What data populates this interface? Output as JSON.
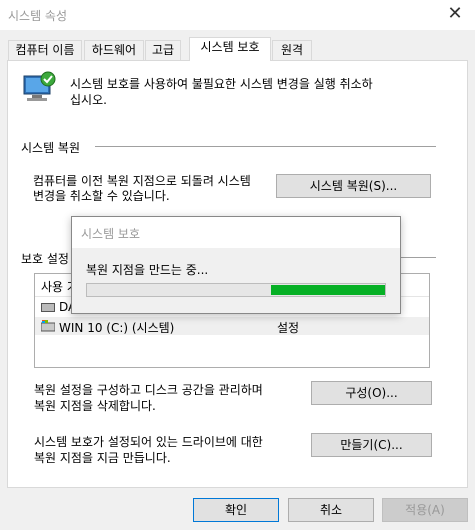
{
  "window": {
    "title": "시스템 속성",
    "close_glyph": "✕"
  },
  "tabs": [
    "컴퓨터 이름",
    "하드웨어",
    "고급",
    "시스템 보호",
    "원격"
  ],
  "active_tab_index": 3,
  "intro_text_1": "시스템 보호를 사용하여 불필요한 시스템 변경을 실행 취소하",
  "intro_text_2": "십시오.",
  "restore_section": {
    "heading": "시스템 복원",
    "desc_1": "컴퓨터를 이전 복원 지점으로 되돌려 시스템",
    "desc_2": "변경을 취소할 수 있습니다.",
    "button_label": "시스템 복원(S)..."
  },
  "protection_section": {
    "heading_visible": "보호 설정",
    "list_header_visible": "사용 가",
    "drives": [
      {
        "name": "DA",
        "status": ""
      },
      {
        "name": "WIN 10 (C:) (시스템)",
        "status": "설정"
      }
    ]
  },
  "configure": {
    "desc_1": "복원 설정을 구성하고 디스크 공간을 관리하며",
    "desc_2": "복원 지점을 삭제합니다.",
    "button_label": "구성(O)..."
  },
  "create": {
    "desc_1": "시스템 보호가 설정되어 있는 드라이브에 대한",
    "desc_2": "복원 지점을 지금 만듭니다.",
    "button_label": "만들기(C)..."
  },
  "footer": {
    "ok": "확인",
    "cancel": "취소",
    "apply": "적용(A)"
  },
  "progress_dialog": {
    "title": "시스템 보호",
    "message": "복원 지점을 만드는 중...",
    "progress_indicator": "marquee"
  },
  "colors": {
    "progress_green": "#06b025",
    "disabled_text": "#999999"
  }
}
